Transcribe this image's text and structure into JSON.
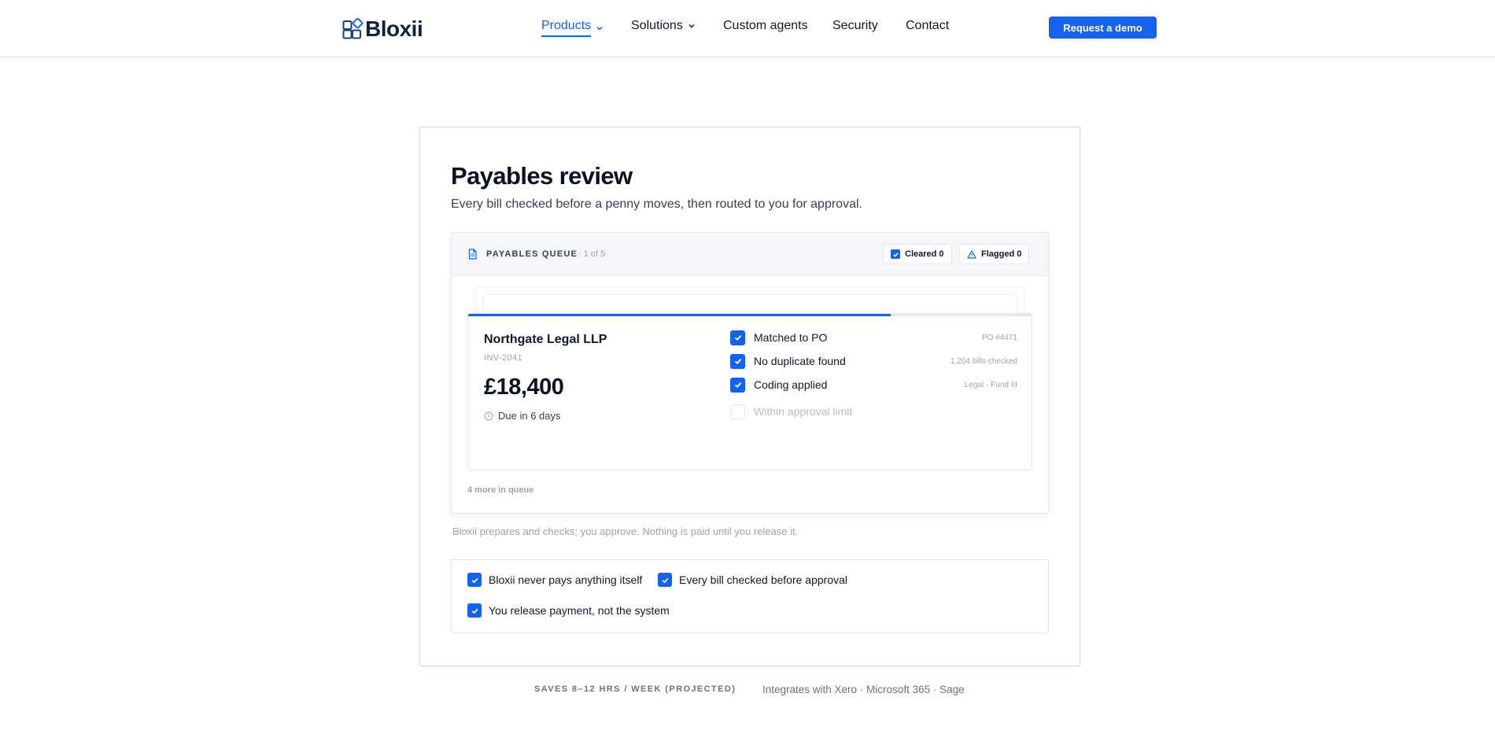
{
  "brand": {
    "name": "Bloxii",
    "accent": "#1662f0"
  },
  "nav": {
    "items": [
      {
        "label": "Products",
        "active": true,
        "dropdown": true
      },
      {
        "label": "Solutions",
        "active": false,
        "dropdown": true
      },
      {
        "label": "Custom agents",
        "active": false,
        "dropdown": false
      },
      {
        "label": "Security",
        "active": false,
        "dropdown": false
      },
      {
        "label": "Contact",
        "active": false,
        "dropdown": false
      }
    ],
    "cta": "Request a demo"
  },
  "main": {
    "title": "Payables review",
    "subtitle": "Every bill checked before a penny moves, then routed to you for approval.",
    "queue": {
      "title": "PAYABLES QUEUE",
      "position": "· 1 of 5",
      "cleared_label": "Cleared 0",
      "flagged_label": "Flagged 0",
      "progress_fraction": 0.75,
      "bill": {
        "vendor": "Northgate Legal LLP",
        "invoice": "INV-2041",
        "amount": "£18,400",
        "due": "Due in 6 days",
        "checks": [
          {
            "label": "Matched to PO",
            "meta": "PO #4471",
            "checked": true
          },
          {
            "label": "No duplicate found",
            "meta": "1,204 bills checked",
            "checked": true
          },
          {
            "label": "Coding applied",
            "meta": "Legal · Fund III",
            "checked": true
          },
          {
            "label": "Within approval limit",
            "meta": "",
            "checked": false
          }
        ]
      },
      "more": "4 more in queue"
    },
    "note": "Bloxii prepares and checks; you approve. Nothing is paid until you release it.",
    "assurances": [
      {
        "label": "Bloxii never pays anything itself",
        "checked": true
      },
      {
        "label": "Every bill checked before approval",
        "checked": true
      },
      {
        "label": "You release payment, not the system",
        "checked": true
      }
    ]
  },
  "footer": {
    "savings": "SAVES 8–12 HRS / WEEK (PROJECTED)",
    "integrations": "Integrates with Xero · Microsoft 365 · Sage"
  }
}
